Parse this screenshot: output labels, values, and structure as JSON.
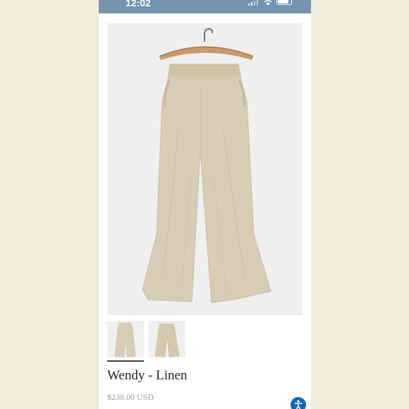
{
  "status_bar": {
    "time": "12:02",
    "battery_level": "87",
    "icons": [
      "signal-icon",
      "wifi-icon",
      "battery-icon"
    ]
  },
  "product": {
    "images": [
      {
        "name": "main-product-photo",
        "alt": ""
      },
      {
        "name": "thumbnail-front"
      },
      {
        "name": "thumbnail-back"
      }
    ],
    "title": "Wendy - Linen",
    "price": "$238.00 USD"
  },
  "floating_actions": {
    "accessibility_icon": "accessibility-icon"
  },
  "colors": {
    "background": "#f1ecd9",
    "status_bar": "#7393ae",
    "fabric": "#d9ccb4",
    "accessibility_button": "#1565c0"
  }
}
